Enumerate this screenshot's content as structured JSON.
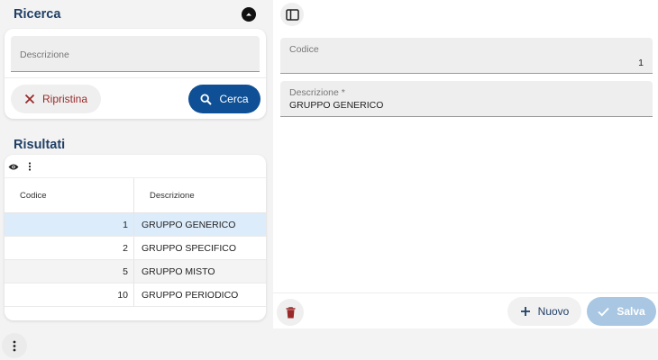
{
  "search_section": {
    "title": "Ricerca",
    "collapse_icon": "chevron-up-circle-icon",
    "description_label": "Descrizione",
    "reset_label": "Ripristina",
    "search_label": "Cerca"
  },
  "results_section": {
    "title": "Risultati",
    "columns": [
      "Codice",
      "Descrizione"
    ],
    "rows": [
      {
        "codice": "1",
        "descrizione": "GRUPPO GENERICO",
        "selected": true
      },
      {
        "codice": "2",
        "descrizione": "GRUPPO SPECIFICO",
        "selected": false
      },
      {
        "codice": "5",
        "descrizione": "GRUPPO MISTO",
        "selected": false
      },
      {
        "codice": "10",
        "descrizione": "GRUPPO PERIODICO",
        "selected": false
      }
    ]
  },
  "detail": {
    "codice_label": "Codice",
    "codice_value": "1",
    "descrizione_label": "Descrizione *",
    "descrizione_value": "GRUPPO GENERICO",
    "new_label": "Nuovo",
    "save_label": "Salva"
  },
  "colors": {
    "primary": "#0e4f95",
    "title": "#1f3f66",
    "danger": "#9a2a2a",
    "selected_row": "#dcecfb",
    "save_disabled": "#a9c7e2"
  }
}
